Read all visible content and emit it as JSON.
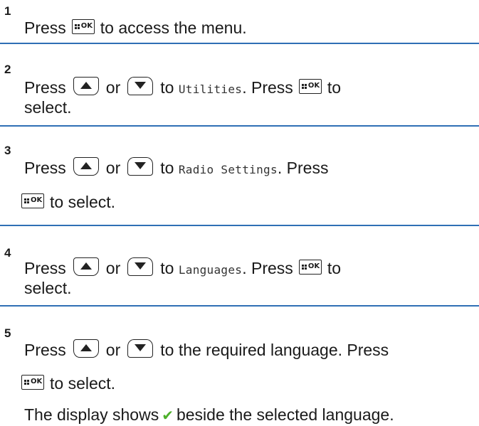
{
  "steps": [
    {
      "number": "1",
      "line1": {
        "press": "Press",
        "after": "to access the menu."
      }
    },
    {
      "number": "2",
      "line1": {
        "press": "Press",
        "or": "or",
        "to": "to",
        "menu_item": "Utilities",
        "press2": ". Press",
        "to2": "to"
      },
      "line2": "select."
    },
    {
      "number": "3",
      "line1": {
        "press": "Press",
        "or": "or",
        "to": "to",
        "menu_item": "Radio Settings",
        "press2": ". Press"
      },
      "line2": "to select."
    },
    {
      "number": "4",
      "line1": {
        "press": "Press",
        "or": "or",
        "to": "to",
        "menu_item": "Languages",
        "press2": ". Press",
        "to2": "to"
      },
      "line2": "select."
    },
    {
      "number": "5",
      "line1": {
        "press": "Press",
        "or": "or",
        "to": "to the required language. Press"
      },
      "line2": "to select.",
      "result": {
        "before": "The display shows",
        "after": "beside the selected language."
      }
    }
  ],
  "icons": {
    "ok_button": "menu-ok-button-icon",
    "up_button": "up-arrow-button-icon",
    "down_button": "down-arrow-button-icon",
    "check": "checkmark-icon"
  },
  "colors": {
    "separator": "#2f6fb5",
    "check": "#4caf2a"
  }
}
